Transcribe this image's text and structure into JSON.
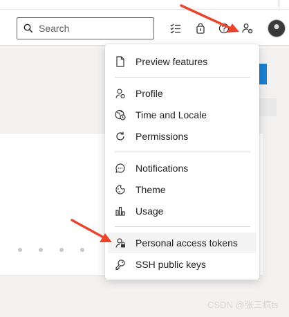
{
  "search": {
    "placeholder": "Search"
  },
  "header_icons": [
    {
      "name": "work-items-icon"
    },
    {
      "name": "marketplace-bag-icon"
    },
    {
      "name": "help-icon"
    },
    {
      "name": "user-settings-icon"
    }
  ],
  "menu": {
    "groups": [
      {
        "items": [
          {
            "label": "Preview features",
            "icon": "document-icon"
          }
        ]
      },
      {
        "items": [
          {
            "label": "Profile",
            "icon": "profile-icon"
          },
          {
            "label": "Time and Locale",
            "icon": "globe-clock-icon"
          },
          {
            "label": "Permissions",
            "icon": "refresh-icon"
          }
        ]
      },
      {
        "items": [
          {
            "label": "Notifications",
            "icon": "chat-bubble-icon"
          },
          {
            "label": "Theme",
            "icon": "theme-icon"
          },
          {
            "label": "Usage",
            "icon": "bar-chart-icon"
          }
        ]
      },
      {
        "items": [
          {
            "label": "Personal access tokens",
            "icon": "token-icon",
            "highlighted": true
          },
          {
            "label": "SSH public keys",
            "icon": "key-icon"
          }
        ]
      }
    ]
  },
  "watermark": "CSDN @张三疯ts",
  "colors": {
    "accent": "#1a7fd4",
    "arrow": "#e8452c"
  }
}
